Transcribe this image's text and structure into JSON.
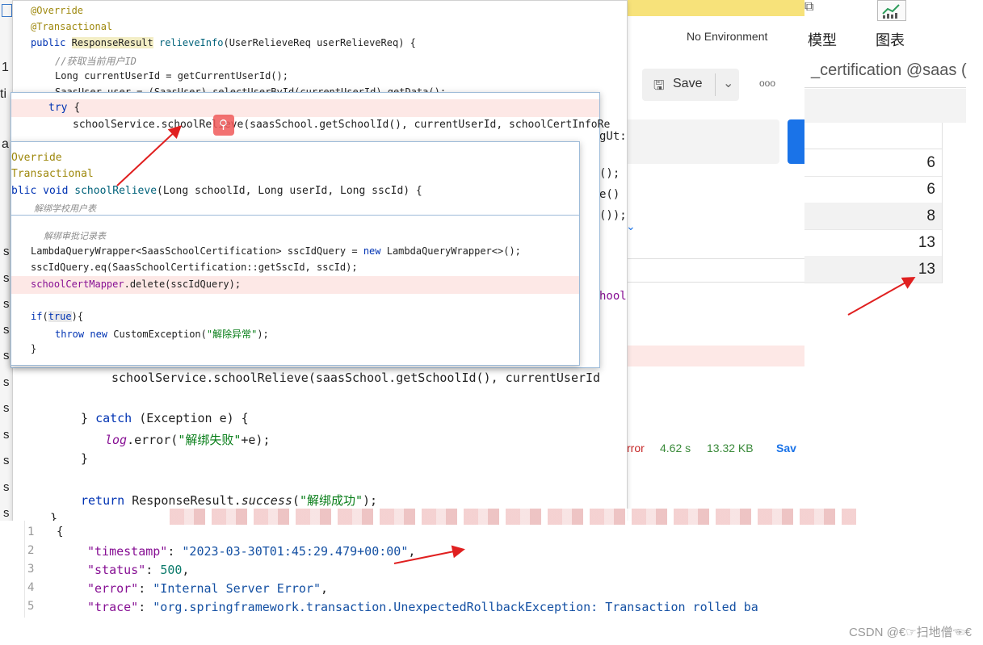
{
  "postman": {
    "tab_partial": "t:",
    "environment": "No Environment",
    "save_label": "Save",
    "more": "ooo",
    "status_error_partial": "rror",
    "time": "4.62 s",
    "size": "13.32 KB",
    "save_response_partial": "Sav"
  },
  "dbtool": {
    "menu_model_partial": "模型",
    "menu_chart": "图表",
    "tab_title": "_certification @saas (",
    "values": [
      "6",
      "6",
      "8",
      "13",
      "13"
    ]
  },
  "ide_back": {
    "line1": "@Override",
    "line2": "@Transactional",
    "line3_kw": "public",
    "line3_type": "ResponseResult",
    "line3_fn": "relieveInfo",
    "line3_rest": "(UserRelieveReq userRelieveReq) {",
    "line4_cmt": "//获取当前用户ID",
    "line5": "Long currentUserId = getCurrentUserId();",
    "line6": "SaasUser user = (SaasUser) selectUserById(currentUserId).getData();",
    "frag_gut": "gUt:",
    "frag_a": "();",
    "frag_b": "e()",
    "frag_c": "());",
    "frag_hool": "hool",
    "call_line": "schoolService.schoolRelieve(saasSchool.getSchoolId(), currentUserId",
    "catch_brace": "}",
    "catch_kw": "catch",
    "catch_rest": "(Exception e) {",
    "log": "log",
    "log_rest": ".error(",
    "log_str": "\"解绑失败\"",
    "log_end": "+e);",
    "close1": "}",
    "return_kw": "return",
    "return_obj": "ResponseResult.",
    "return_fn": "success",
    "return_str": "\"解绑成功\"",
    "return_end": ");",
    "close2": "}"
  },
  "popup1": {
    "try_kw": "try",
    "try_brace": "{",
    "call": "schoolService.schoolRelieve(saasSchool.getSchoolId(), currentUserId, schoolCertInfoRe"
  },
  "popup2": {
    "line1": "Override",
    "line2": "Transactional",
    "line3_kw": "blic void",
    "line3_fn": "schoolRelieve",
    "line3_rest": "(Long schoolId, Long userId, Long sscId) {",
    "line4_cmt": "解绑学校用户表",
    "line5_cmt": "解绑审批记录表",
    "line6": "LambdaQueryWrapper<SaasSchoolCertification> sscIdQuery = ",
    "line6_kw": "new",
    "line6_rest": " LambdaQueryWrapper<>();",
    "line7": "sscIdQuery.eq(SaasSchoolCertification::getSscId, sscId);",
    "line8_field": "schoolCertMapper",
    "line8_rest": ".delete(sscIdQuery);",
    "line9_kw": "if",
    "line9_a": "(",
    "line9_true": "true",
    "line9_b": "){",
    "line10_kw1": "throw",
    "line10_kw2": "new",
    "line10_cls": "CustomException(",
    "line10_str": "\"解除异常\"",
    "line10_end": ");",
    "line11": "}"
  },
  "json": {
    "lines": [
      {
        "num": "1",
        "text": "{"
      },
      {
        "num": "2",
        "key": "\"timestamp\"",
        "val": "\"2023-03-30T01:45:29.479+00:00\"",
        "end": ","
      },
      {
        "num": "3",
        "key": "\"status\"",
        "val": "500",
        "end": ","
      },
      {
        "num": "4",
        "key": "\"error\"",
        "val": "\"Internal Server Error\"",
        "end": ","
      },
      {
        "num": "5",
        "key": "\"trace\"",
        "val": "\"org.springframework.transaction.UnexpectedRollbackException: Transaction rolled ba",
        "end": ""
      }
    ]
  },
  "left_fragments": [
    "1",
    "ti",
    "a",
    "s",
    "s",
    "s",
    "s",
    "s",
    "s",
    "s",
    "s",
    "s",
    "s",
    "s",
    "s"
  ],
  "watermark": "CSDN @€☞扫地僧☜€"
}
